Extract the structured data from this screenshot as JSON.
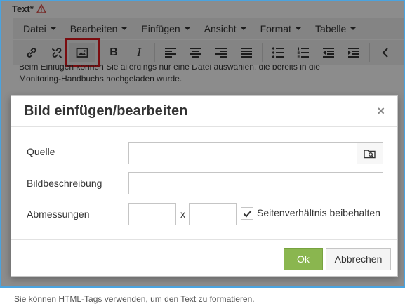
{
  "field": {
    "label": "Text*"
  },
  "menubar": {
    "items": [
      {
        "label": "Datei"
      },
      {
        "label": "Bearbeiten"
      },
      {
        "label": "Einfügen"
      },
      {
        "label": "Ansicht"
      },
      {
        "label": "Format"
      },
      {
        "label": "Tabelle"
      }
    ]
  },
  "toolbar": {
    "bold_label": "B",
    "italic_label": "I"
  },
  "content": {
    "line1": "Beim Einfügen können Sie allerdings nur eine Datei auswählen, die bereits in die",
    "line2": "Monitoring-Handbuchs hochgeladen wurde."
  },
  "bottom_hint": "Sie können HTML-Tags verwenden, um den Text zu formatieren.",
  "dialog": {
    "title": "Bild einfügen/bearbeiten",
    "close": "×",
    "source_label": "Quelle",
    "source_value": "",
    "description_label": "Bildbeschreibung",
    "description_value": "",
    "dimensions_label": "Abmessungen",
    "width_value": "",
    "height_value": "",
    "times": "x",
    "constrain_label": "Seitenverhältnis beibehalten",
    "constrain_checked": true,
    "ok_label": "Ok",
    "cancel_label": "Abbrechen"
  },
  "colors": {
    "highlight_border": "#e0161d",
    "ok_button": "#8ab64f",
    "frame": "#4aa3df",
    "warning": "#d9534f"
  }
}
